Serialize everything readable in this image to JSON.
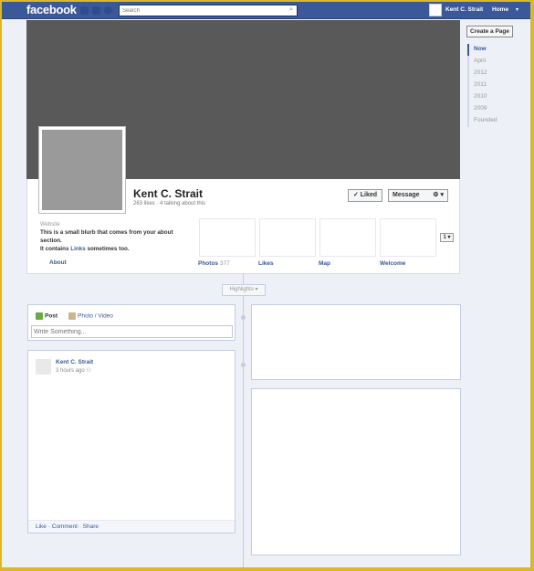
{
  "topbar": {
    "logo": "facebook",
    "search_placeholder": "Search",
    "user_name": "Kent C. Strait",
    "home_label": "Home",
    "menu_caret": "▾"
  },
  "profile": {
    "name": "Kent C. Strait",
    "stats": "263 likes · 4 talking about this",
    "liked_label": "✓ Liked",
    "message_label": "Message",
    "gear_label": "⚙ ▾"
  },
  "about": {
    "label": "Website",
    "text_1": "This is a small blurb that comes from your about section.",
    "text_2_pre": "It contains ",
    "text_2_link": "Links",
    "text_2_post": " sometimes too.",
    "about_link": "About"
  },
  "apps": [
    {
      "label": "Photos",
      "count": "377"
    },
    {
      "label": "Likes",
      "count": ""
    },
    {
      "label": "Map",
      "count": ""
    },
    {
      "label": "Welcome",
      "count": ""
    }
  ],
  "apps_pager": "1 ▾",
  "highlights": "Highlights ▾",
  "composer": {
    "tab_post": "Post",
    "tab_photo": "Photo / Video",
    "placeholder": "Write Something..."
  },
  "post": {
    "author": "Kent C. Strait",
    "time": "3 hours ago",
    "privacy_icon": "⚇",
    "actions": "Like · Comment · Share"
  },
  "sidebar": {
    "create_page": "Create a Page",
    "nav": [
      "Now",
      "April",
      "2012",
      "2011",
      "2010",
      "2009",
      "Founded"
    ]
  },
  "colors": {
    "brand": "#3b5998",
    "cover": "#595959",
    "background": "#edf0f7"
  }
}
